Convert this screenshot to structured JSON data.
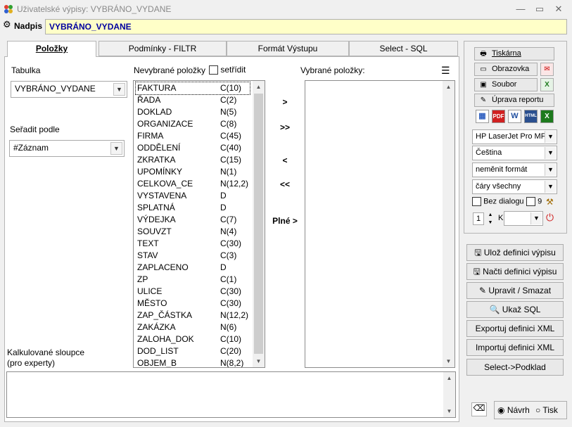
{
  "window": {
    "title": "Uživatelské výpisy: VYBRÁNO_VYDANE",
    "minimize": "—",
    "maximize": "▭",
    "close": "✕"
  },
  "header": {
    "nadpis_label": "Nadpis",
    "nadpis_value": "VYBRÁNO_VYDANE"
  },
  "tabs": [
    {
      "label": "Položky"
    },
    {
      "label": "Podmínky - FILTR"
    },
    {
      "label": "Formát Výstupu"
    },
    {
      "label": "Select - SQL"
    }
  ],
  "left": {
    "tabulka_label": "Tabulka",
    "tabulka_value": "VYBRÁNO_VYDANE",
    "seradit_label": "Seřadit podle",
    "seradit_value": "#Záznam",
    "kalk_label_1": "Kalkulované sloupce",
    "kalk_label_2": "(pro experty)"
  },
  "unselected": {
    "label": "Nevybrané položky",
    "sort_label": "setřídit",
    "items": [
      {
        "name": "FAKTURA",
        "type": "C(10)"
      },
      {
        "name": "ŘADA",
        "type": "C(2)"
      },
      {
        "name": "DOKLAD",
        "type": "N(5)"
      },
      {
        "name": "ORGANIZACE",
        "type": "C(8)"
      },
      {
        "name": "FIRMA",
        "type": "C(45)"
      },
      {
        "name": "ODDĚLENÍ",
        "type": "C(40)"
      },
      {
        "name": "ZKRATKA",
        "type": "C(15)"
      },
      {
        "name": "UPOMÍNKY",
        "type": "N(1)"
      },
      {
        "name": "CELKOVA_CE",
        "type": "N(12,2)"
      },
      {
        "name": "VYSTAVENA",
        "type": "D"
      },
      {
        "name": "SPLATNÁ",
        "type": "D"
      },
      {
        "name": "VÝDEJKA",
        "type": "C(7)"
      },
      {
        "name": "SOUVZT",
        "type": "N(4)"
      },
      {
        "name": "TEXT",
        "type": "C(30)"
      },
      {
        "name": "STAV",
        "type": "C(3)"
      },
      {
        "name": "ZAPLACENO",
        "type": "D"
      },
      {
        "name": "ZP",
        "type": "C(1)"
      },
      {
        "name": "ULICE",
        "type": "C(30)"
      },
      {
        "name": "MĚSTO",
        "type": "C(30)"
      },
      {
        "name": "ZAP_ČÁSTKA",
        "type": "N(12,2)"
      },
      {
        "name": "ZAKÁZKA",
        "type": "N(6)"
      },
      {
        "name": "ZALOHA_DOK",
        "type": "C(10)"
      },
      {
        "name": "DOD_LIST",
        "type": "C(20)"
      },
      {
        "name": "OBJEM_B",
        "type": "N(8,2)"
      }
    ]
  },
  "transfer": {
    "add": ">",
    "add_all": ">>",
    "remove": "<",
    "remove_all": "<<",
    "full": "Plné >"
  },
  "selected": {
    "label": "Vybrané položky:"
  },
  "output": {
    "printer": "Tiskárna",
    "screen": "Obrazovka",
    "file": "Soubor",
    "edit_report": "Úprava reportu",
    "formats": [
      "PDF",
      "W",
      "HTML",
      "X"
    ],
    "printer_select": "HP LaserJet Pro MFP",
    "language_select": "Čeština",
    "format_select": "neměnit formát",
    "lines_select": "čáry všechny",
    "no_dialog_label": "Bez dialogu",
    "nine_label": "9",
    "copies_value": "1",
    "copies_suffix": "K"
  },
  "actions": {
    "save_def": "Ulož definici výpisu",
    "load_def": "Načti definici výpisu",
    "edit_delete": "Upravit / Smazat",
    "show_sql": "Ukaž SQL",
    "export_xml": "Exportuj definici XML",
    "import_xml": "Importuj definici XML",
    "select_podklad": "Select->Podklad"
  },
  "mode": {
    "design_label": "Návrh",
    "print_label": "Tisk",
    "selected": "design"
  },
  "colors": {
    "nadpis_bg": "#ffffc8",
    "nadpis_text": "#0000a0"
  }
}
